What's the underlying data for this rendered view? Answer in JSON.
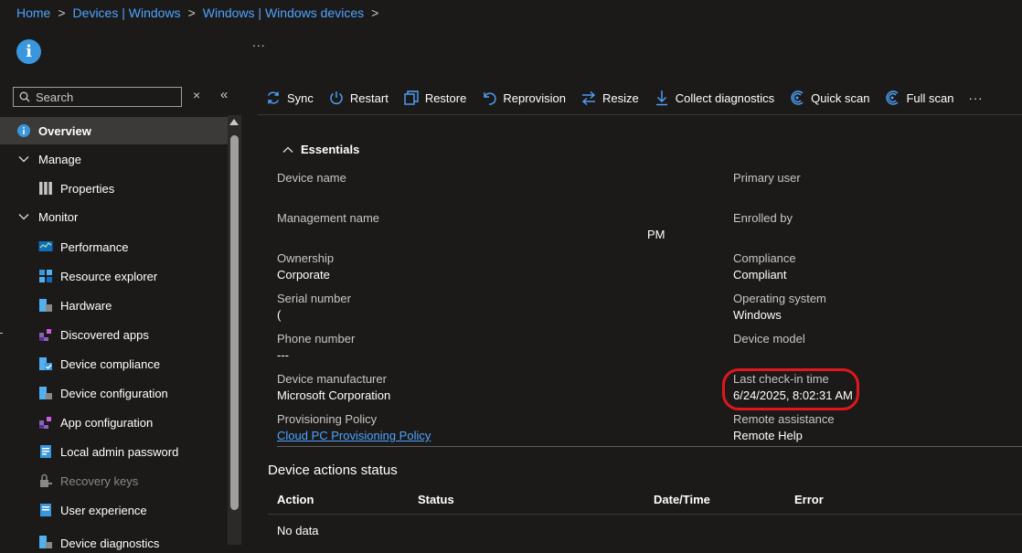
{
  "breadcrumb": {
    "items": [
      "Home",
      "Devices | Windows",
      "Windows | Windows devices"
    ],
    "separator": ">"
  },
  "header": {
    "more_label": "..."
  },
  "search": {
    "placeholder": "Search",
    "clear_glyph": "×",
    "collapse_glyph": "«"
  },
  "nav": {
    "overview": "Overview",
    "manage": "Manage",
    "properties": "Properties",
    "monitor": "Monitor",
    "performance": "Performance",
    "resource_explorer": "Resource explorer",
    "hardware": "Hardware",
    "discovered_apps": "Discovered apps",
    "device_compliance": "Device compliance",
    "device_configuration": "Device configuration",
    "app_configuration": "App configuration",
    "local_admin_password": "Local admin password",
    "recovery_keys": "Recovery keys",
    "user_experience": "User experience",
    "device_diagnostics": "Device diagnostics"
  },
  "toolbar": {
    "sync": "Sync",
    "restart": "Restart",
    "restore": "Restore",
    "reprovision": "Reprovision",
    "resize": "Resize",
    "collect_diagnostics": "Collect diagnostics",
    "quick_scan": "Quick scan",
    "full_scan": "Full scan",
    "more": "···"
  },
  "essentials": {
    "title": "Essentials",
    "device_name_label": "Device name",
    "management_name_label": "Management name",
    "management_name_fragment": "PM",
    "ownership_label": "Ownership",
    "ownership_value": "Corporate",
    "serial_number_label": "Serial number",
    "serial_number_fragment": "(",
    "phone_number_label": "Phone number",
    "phone_number_value": "---",
    "manufacturer_label": "Device manufacturer",
    "manufacturer_value": "Microsoft Corporation",
    "provisioning_label": "Provisioning Policy",
    "provisioning_value": "Cloud PC Provisioning Policy",
    "primary_user_label": "Primary user",
    "enrolled_by_label": "Enrolled by",
    "compliance_label": "Compliance",
    "compliance_value": "Compliant",
    "os_label": "Operating system",
    "os_value": "Windows",
    "model_label": "Device model",
    "last_checkin_label": "Last check-in time",
    "last_checkin_value": "6/24/2025, 8:02:31 AM",
    "remote_assistance_label": "Remote assistance",
    "remote_assistance_value": "Remote Help"
  },
  "actions_status": {
    "title": "Device actions status",
    "columns": [
      "Action",
      "Status",
      "Date/Time",
      "Error"
    ],
    "empty_text": "No data"
  },
  "colors": {
    "background": "#1b1a19",
    "link": "#4fa3ff",
    "highlight": "#e0171c",
    "selected_nav": "#3b3a39"
  }
}
